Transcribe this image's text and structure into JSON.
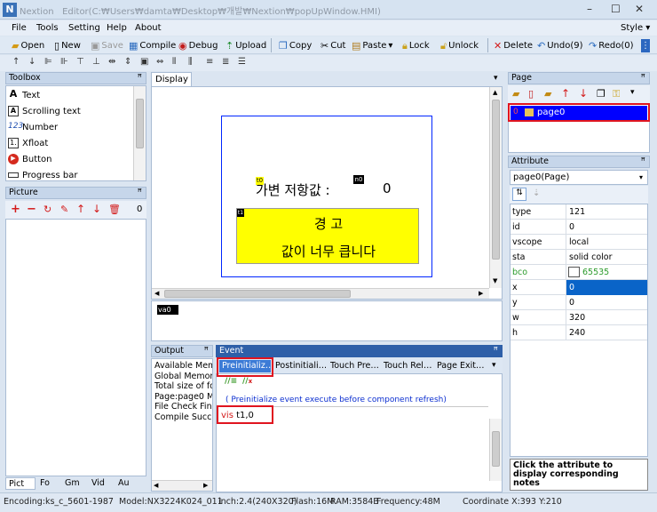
{
  "window": {
    "app_name": "Nextion",
    "title": "Editor(C:₩Users₩damta₩Desktop₩개발₩Nextion₩popUpWindow.HMI)",
    "style_label": "Style"
  },
  "menu": [
    "File",
    "Tools",
    "Setting",
    "Help",
    "About"
  ],
  "toolbar": {
    "open": "Open",
    "new": "New",
    "save": "Save",
    "compile": "Compile",
    "debug": "Debug",
    "upload": "Upload",
    "copy": "Copy",
    "cut": "Cut",
    "paste": "Paste",
    "lock": "Lock",
    "unlock": "Unlock",
    "delete": "Delete",
    "undo": "Undo(9)",
    "redo": "Redo(0)"
  },
  "toolbox": {
    "title": "Toolbox",
    "items": [
      "Text",
      "Scrolling text",
      "Number",
      "Xfloat",
      "Button",
      "Progress bar"
    ]
  },
  "picture": {
    "title": "Picture",
    "count": "0",
    "tabs": [
      "Pict",
      "Fo",
      "Gm",
      "Vid",
      "Au"
    ]
  },
  "display": {
    "tab": "Display",
    "t0_tag": "t0",
    "n0_tag": "n0",
    "t1_tag": "t1",
    "label_text": "가변 저항값 :",
    "number_value": "0",
    "popup_title": "경 고",
    "popup_message": "값이 너무 큽니다",
    "va0_tag": "va0"
  },
  "output": {
    "title": "Output",
    "lines": [
      "Available Mem",
      "Global Memory",
      "Total size of fo",
      "Page:page0 M",
      "File Check Fin",
      "Compile Succe"
    ]
  },
  "event": {
    "title": "Event",
    "tabs": [
      "Preinitializ…",
      "Postinitiali…",
      "Touch Pre…",
      "Touch Rel…",
      "Page Exit…"
    ],
    "description": "( Preinitialize event execute before component refresh)",
    "code_keyword": "vis",
    "code_rest": " t1,0"
  },
  "page": {
    "title": "Page",
    "item_index": "0",
    "item_name": "page0"
  },
  "attribute": {
    "title": "Attribute",
    "selector": "page0(Page)",
    "rows": [
      {
        "k": "type",
        "v": "121"
      },
      {
        "k": "id",
        "v": "0"
      },
      {
        "k": "vscope",
        "v": "local"
      },
      {
        "k": "sta",
        "v": "solid color"
      },
      {
        "k": "bco",
        "v": "65535"
      },
      {
        "k": "x",
        "v": "0"
      },
      {
        "k": "y",
        "v": "0"
      },
      {
        "k": "w",
        "v": "320"
      },
      {
        "k": "h",
        "v": "240"
      }
    ],
    "note": "Click the attribute to display corresponding notes"
  },
  "status": {
    "encoding": "Encoding:ks_c_5601-1987",
    "model": "Model:NX3224K024_011",
    "inch": "inch:2.4(240X320)",
    "flash": "Flash:16M",
    "ram": "RAM:3584B",
    "freq": "Frequency:48M",
    "coord": "Coordinate X:393  Y:210"
  },
  "colors": {
    "accent_blue": "#0026ff",
    "highlight_red": "#e0141f",
    "popup_yellow": "#ffff00",
    "selected_cell": "#0a64c8"
  }
}
